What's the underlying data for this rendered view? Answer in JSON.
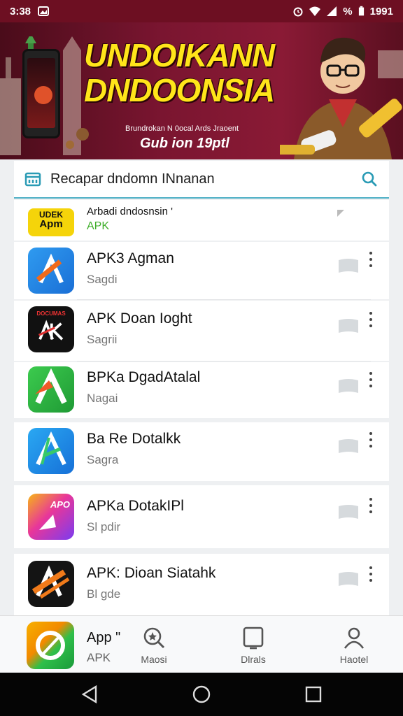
{
  "status_bar": {
    "time": "3:38",
    "clock_right": "1991",
    "battery_text": "%"
  },
  "banner": {
    "headline_1": "UNDOIKANN",
    "headline_2": "DNDOONSIA",
    "tagline": "Brundrokan N 0ocal Ards Jraoent",
    "subline": "Gub ion 19ptl"
  },
  "search": {
    "title": "Recapar dndomn INnanan"
  },
  "partial_row": {
    "icon_text_1": "UDEK",
    "icon_text_2": "Apm",
    "name": "Arbadi dndosnsin '",
    "sub": "APK"
  },
  "apps": [
    {
      "name": "APK3 Agman",
      "sub": "Sagdi",
      "icon": "blue-slash-icon"
    },
    {
      "name": "APK Doan Ioght",
      "sub": "Sagrii",
      "icon": "black-ak-icon",
      "icon_text": "DOCUMAS"
    },
    {
      "name": "BPKa DgadAtalal",
      "sub": "Nagai",
      "icon": "green-a-icon"
    },
    {
      "name": "Ba Re Dotalkk",
      "sub": "Sagra",
      "icon": "blue-a-icon"
    },
    {
      "name": "APKa DotakIPl",
      "sub": "Sl pdir",
      "icon": "gradient-apo-icon",
      "icon_text": "APO"
    },
    {
      "name": "APK: Dioan Siatahk",
      "sub": "Bl gde",
      "icon": "black-stripe-icon"
    }
  ],
  "bottom_nav": {
    "promo_name": "App \"",
    "promo_sub": "APK",
    "items": [
      {
        "label": "Maosi",
        "icon": "search-star-icon"
      },
      {
        "label": "Dlrals",
        "icon": "tablet-icon"
      },
      {
        "label": "Haotel",
        "icon": "profile-icon"
      }
    ]
  }
}
